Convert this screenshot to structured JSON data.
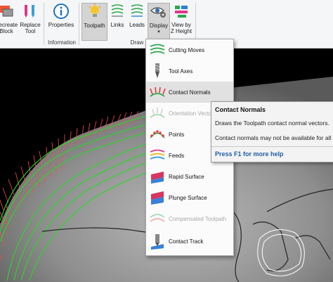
{
  "ribbon": {
    "buttons": [
      {
        "label_line1": "Recreate",
        "label_line2": "Block",
        "icon": "recreate-block-icon"
      },
      {
        "label_line1": "Replace",
        "label_line2": "Tool",
        "icon": "replace-tool-icon"
      },
      {
        "label_line1": "Properties",
        "label_line2": "",
        "icon": "info-icon"
      },
      {
        "label_line1": "Toolpath",
        "label_line2": "",
        "icon": "lightbulb-icon"
      },
      {
        "label_line1": "Links",
        "label_line2": "",
        "icon": "links-icon"
      },
      {
        "label_line1": "Leads",
        "label_line2": "",
        "icon": "leads-icon"
      },
      {
        "label_line1": "Display",
        "label_line2": "",
        "icon": "eye-gear-icon"
      },
      {
        "label_line1": "View by",
        "label_line2": "Z Height",
        "icon": "view-by-z-height-icon"
      }
    ],
    "groups": {
      "information": "Information",
      "draw": "Draw"
    }
  },
  "menu": {
    "items": [
      {
        "label": "Cutting Moves",
        "icon": "cutting-moves-icon",
        "state": "normal"
      },
      {
        "label": "Tool Axes",
        "icon": "tool-axes-icon",
        "state": "normal"
      },
      {
        "label": "Contact Normals",
        "icon": "contact-normals-icon",
        "state": "hover"
      },
      {
        "label": "Orientation Vectors",
        "icon": "orientation-vectors-icon",
        "state": "disabled"
      },
      {
        "label": "Points",
        "icon": "points-icon",
        "state": "normal"
      },
      {
        "label": "Feeds",
        "icon": "feeds-icon",
        "state": "normal"
      },
      {
        "label": "Rapid Surface",
        "icon": "rapid-surface-icon",
        "state": "normal"
      },
      {
        "label": "Plunge Surface",
        "icon": "plunge-surface-icon",
        "state": "normal"
      },
      {
        "label": "Compensated Toolpath",
        "icon": "compensated-toolpath-icon",
        "state": "disabled"
      },
      {
        "label": "Contact Track",
        "icon": "contact-track-icon",
        "state": "normal"
      }
    ]
  },
  "tooltip": {
    "title": "Contact Normals",
    "line1": "Draws the Toolpath contact normal vectors.",
    "line2": "Contact normals may not be available for all",
    "help": "Press F1 for more help"
  },
  "colors": {
    "toolpath_green": "#22dd22",
    "normals_red": "#ff4a4a",
    "surface_gray": "#8a8a8a",
    "help_link": "#1f5ea8"
  }
}
